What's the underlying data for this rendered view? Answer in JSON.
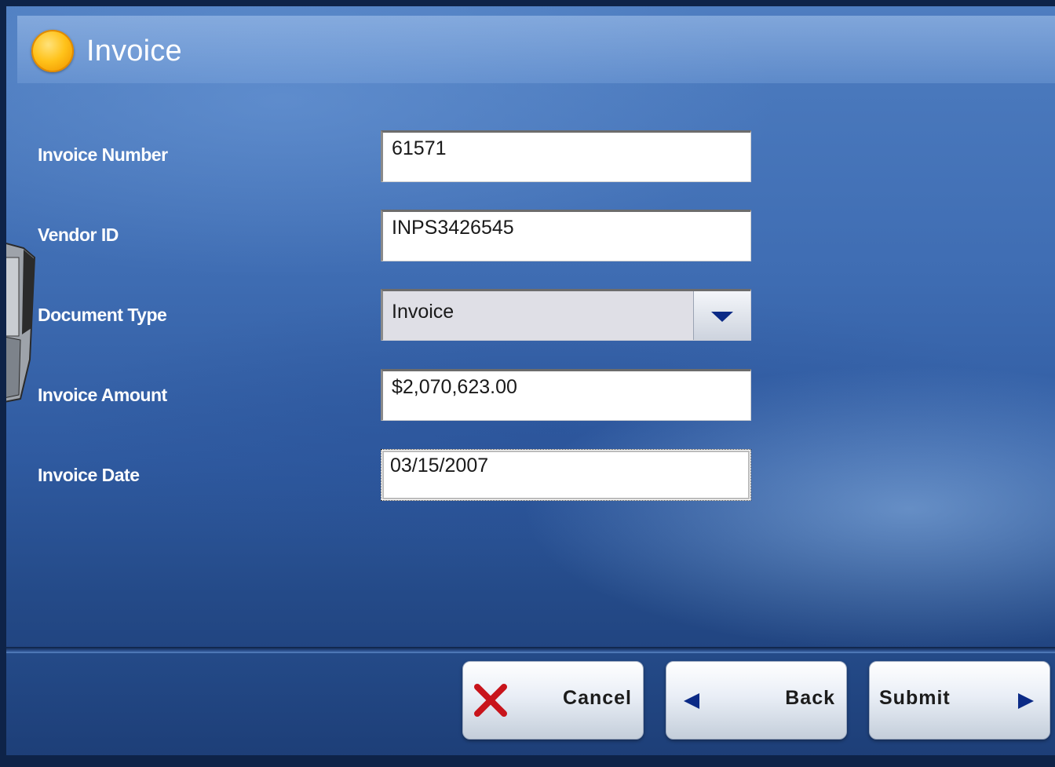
{
  "header": {
    "title": "Invoice",
    "orb_color": "#FFC21A"
  },
  "form": {
    "invoice_number": {
      "label": "Invoice Number",
      "value": "61571"
    },
    "vendor_id": {
      "label": "Vendor ID",
      "value": "INPS3426545"
    },
    "document_type": {
      "label": "Document Type",
      "selected": "Invoice"
    },
    "invoice_amount": {
      "label": "Invoice Amount",
      "value": "$2,070,623.00"
    },
    "invoice_date": {
      "label": "Invoice Date",
      "value": "03/15/2007"
    }
  },
  "footer": {
    "cancel_label": "Cancel",
    "back_label": "Back",
    "submit_label": "Submit"
  },
  "colors": {
    "accent_navy": "#0B2A86",
    "cancel_x": "#C8141B",
    "background_blue": "#3F6DB3"
  },
  "icons": {
    "title": "orange-orb-icon",
    "cancel": "red-x-icon",
    "back": "left-arrow-icon",
    "submit": "right-arrow-icon",
    "dropdown": "chevron-down-icon"
  }
}
